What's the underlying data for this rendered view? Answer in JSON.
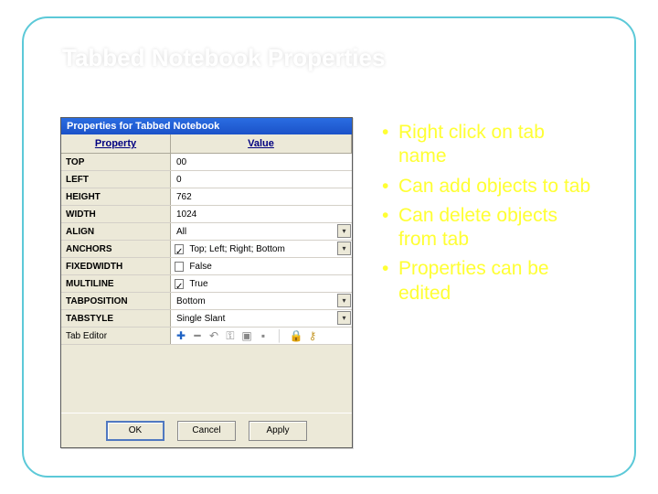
{
  "slide": {
    "title": "Tabbed Notebook Properties"
  },
  "dialog": {
    "title": "Properties for Tabbed Notebook",
    "col_property": "Property",
    "col_value": "Value",
    "rows": [
      {
        "label": "TOP",
        "value": "00"
      },
      {
        "label": "LEFT",
        "value": "0"
      },
      {
        "label": "HEIGHT",
        "value": "762"
      },
      {
        "label": "WIDTH",
        "value": "1024"
      },
      {
        "label": "ALIGN",
        "value": "All",
        "dropdown": true
      },
      {
        "label": "ANCHORS",
        "value": "Top; Left; Right; Bottom",
        "checkbox": true,
        "checked": true,
        "dropdown": true
      },
      {
        "label": "FIXEDWIDTH",
        "value": "False",
        "checkbox": true,
        "checked": false
      },
      {
        "label": "MULTILINE",
        "value": "True",
        "checkbox": true,
        "checked": true
      },
      {
        "label": "TABPOSITION",
        "value": "Bottom",
        "dropdown": true
      },
      {
        "label": "TABSTYLE",
        "value": "Single Slant",
        "dropdown": true
      },
      {
        "label": "Tab Editor",
        "value": "",
        "toolbar": true
      }
    ],
    "buttons": {
      "ok": "OK",
      "cancel": "Cancel",
      "apply": "Apply"
    }
  },
  "bullets": [
    "Right click on tab name",
    "Can add objects to tab",
    "Can delete objects from tab",
    "Properties can be edited"
  ],
  "icons": [
    "plus",
    "minus",
    "undo",
    "key",
    "open",
    "save",
    "sep",
    "lock",
    "keyhole"
  ]
}
